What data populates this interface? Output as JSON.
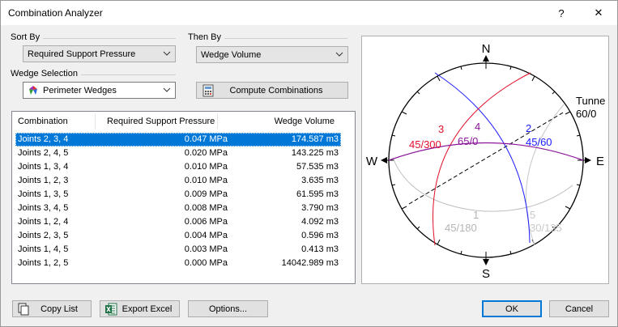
{
  "window": {
    "title": "Combination Analyzer",
    "help_glyph": "?",
    "close_glyph": "✕"
  },
  "sort_by": {
    "label": "Sort By",
    "value": "Required Support Pressure"
  },
  "then_by": {
    "label": "Then By",
    "value": "Wedge Volume"
  },
  "wedge_selection": {
    "label": "Wedge Selection",
    "value": "Perimeter Wedges"
  },
  "compute_button": {
    "label": "Compute Combinations"
  },
  "table": {
    "headers": [
      "Combination",
      "Required Support Pressure",
      "Wedge Volume"
    ],
    "rows": [
      [
        "Joints 2, 3, 4",
        "0.047 MPa",
        "174.587 m3"
      ],
      [
        "Joints 2, 4, 5",
        "0.020 MPa",
        "143.225 m3"
      ],
      [
        "Joints 1, 3, 4",
        "0.010 MPa",
        "57.535 m3"
      ],
      [
        "Joints 1, 2, 3",
        "0.010 MPa",
        "3.635 m3"
      ],
      [
        "Joints 1, 3, 5",
        "0.009 MPa",
        "61.595 m3"
      ],
      [
        "Joints 3, 4, 5",
        "0.008 MPa",
        "3.790 m3"
      ],
      [
        "Joints 1, 2, 4",
        "0.006 MPa",
        "4.092 m3"
      ],
      [
        "Joints 2, 3, 5",
        "0.004 MPa",
        "0.596 m3"
      ],
      [
        "Joints 1, 4, 5",
        "0.003 MPa",
        "0.413 m3"
      ],
      [
        "Joints 1, 2, 5",
        "0.000 MPa",
        "14042.989 m3"
      ]
    ],
    "selected_index": 0
  },
  "stereonet": {
    "north": "N",
    "south": "S",
    "east": "E",
    "west": "W",
    "tunnel_label": "Tunne",
    "tunnel_orientation": "60/0",
    "joints": [
      {
        "id": "1",
        "orientation": "45/180",
        "color": "#b4b4b4"
      },
      {
        "id": "2",
        "orientation": "45/60",
        "color": "#1a1aff"
      },
      {
        "id": "3",
        "orientation": "45/300",
        "color": "#e0102a"
      },
      {
        "id": "4",
        "orientation": "65/0",
        "color": "#8a159a"
      },
      {
        "id": "5",
        "orientation": "30/135",
        "color": "#c8c8c8"
      }
    ]
  },
  "footer": {
    "copy_list": "Copy List",
    "export_excel": "Export Excel",
    "options": "Options...",
    "ok": "OK",
    "cancel": "Cancel"
  }
}
